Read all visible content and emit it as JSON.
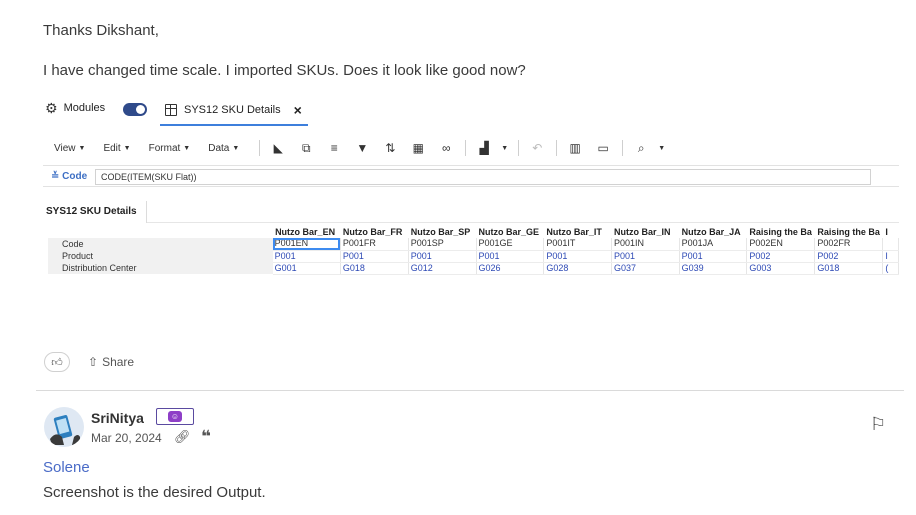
{
  "post": {
    "line1": "Thanks Dikshant,",
    "line2": "I have changed time scale. I imported SKUs. Does it look like good now?"
  },
  "screenshot": {
    "tabs": {
      "modules": "Modules",
      "sku_tab": "SYS12 SKU Details"
    },
    "menus": [
      "View",
      "Edit",
      "Format",
      "Data"
    ],
    "formula": {
      "label": "Code",
      "value": "CODE(ITEM(SKU Flat))"
    },
    "sheet_tab": "SYS12 SKU Details",
    "grid": {
      "columns": [
        "Nutzo Bar_EN",
        "Nutzo Bar_FR",
        "Nutzo Bar_SP",
        "Nutzo Bar_GE",
        "Nutzo Bar_IT",
        "Nutzo Bar_IN",
        "Nutzo Bar_JA",
        "Raising the Ba",
        "Raising the Ba",
        "I"
      ],
      "rows": [
        {
          "label": "Code",
          "cells": [
            "P001EN",
            "P001FR",
            "P001SP",
            "P001GE",
            "P001IT",
            "P001IN",
            "P001JA",
            "P002EN",
            "P002FR",
            ""
          ]
        },
        {
          "label": "Product",
          "cells": [
            "P001",
            "P001",
            "P001",
            "P001",
            "P001",
            "P001",
            "P001",
            "P002",
            "P002",
            "I"
          ]
        },
        {
          "label": "Distribution Center",
          "cells": [
            "G001",
            "G018",
            "G012",
            "G026",
            "G028",
            "G037",
            "G039",
            "G003",
            "G018",
            "("
          ]
        }
      ]
    }
  },
  "actions": {
    "share": "Share"
  },
  "reply": {
    "username": "SriNitya",
    "date": "Mar 20, 2024",
    "mention": "Solene",
    "text": "Screenshot is the desired Output."
  },
  "colors": {
    "link": "#4a6bc7",
    "badge": "#8e3fc7",
    "selection": "#3d8bf0"
  }
}
